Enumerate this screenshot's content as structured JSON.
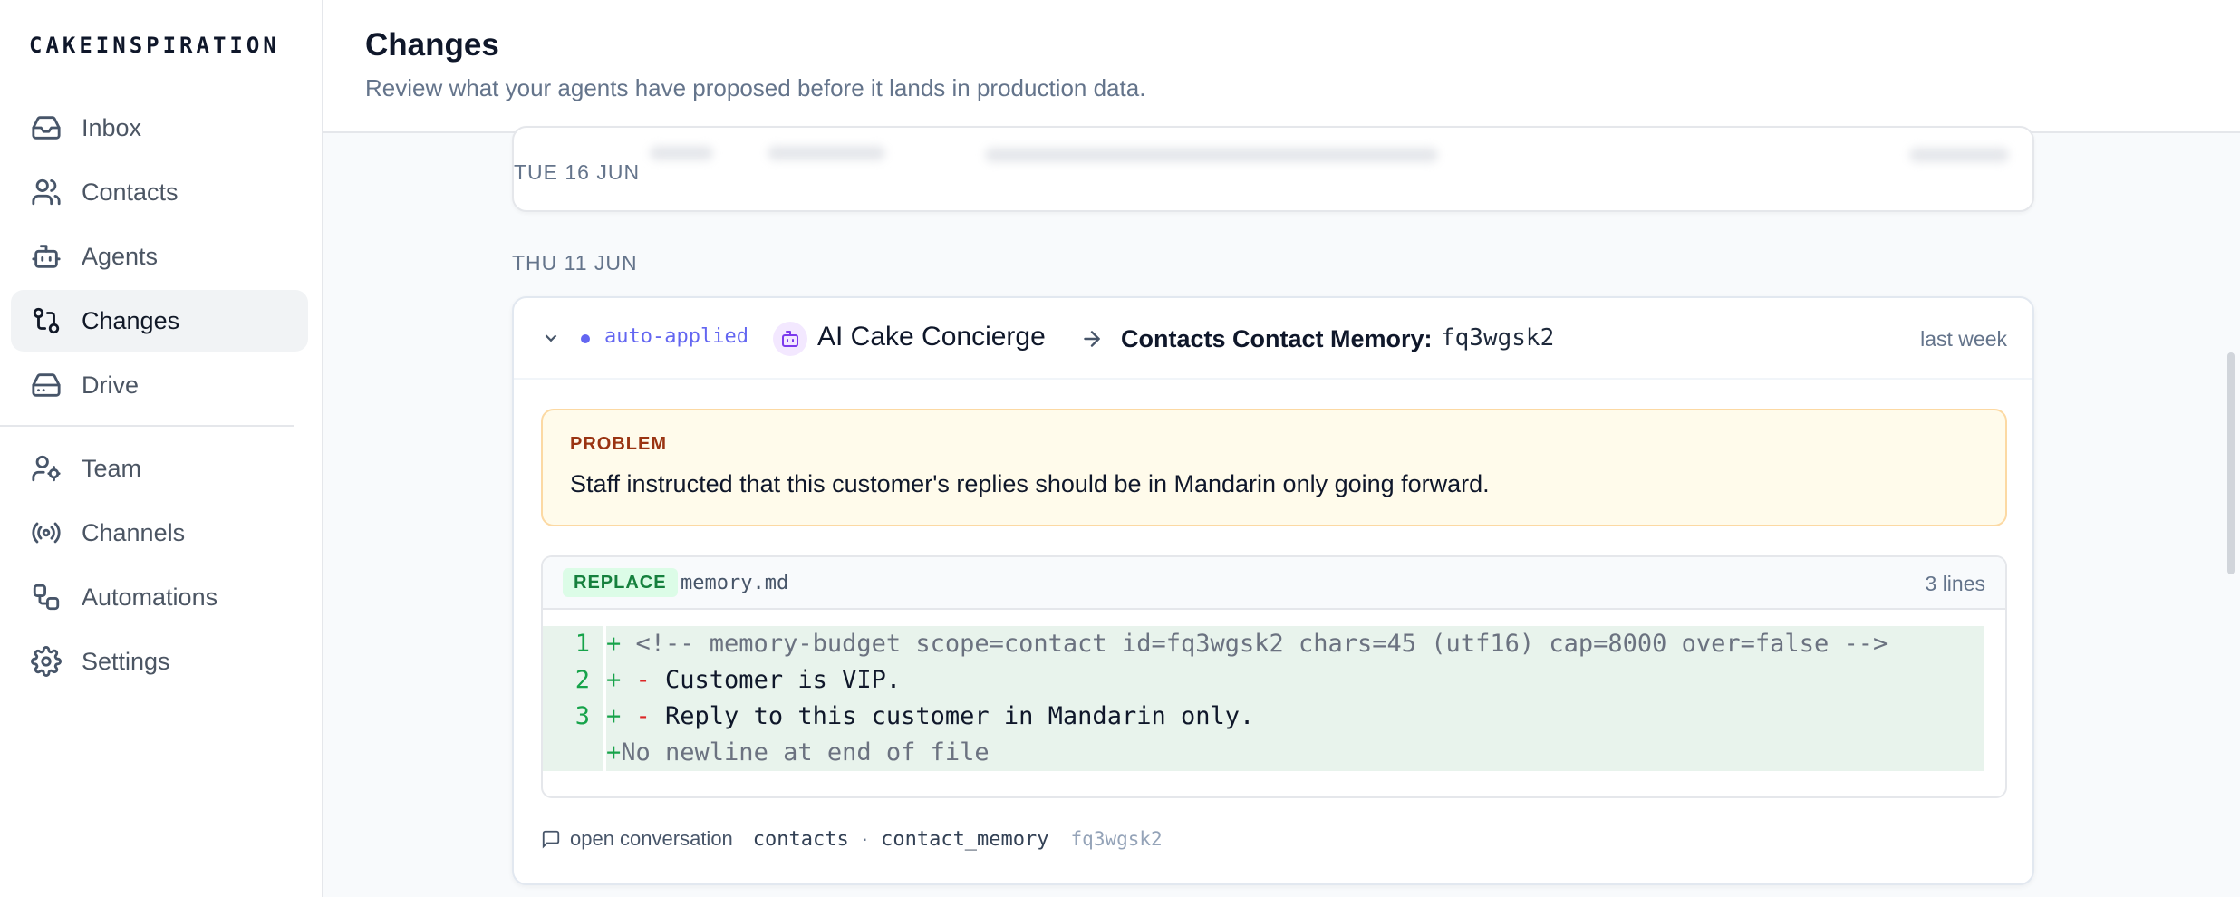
{
  "brand": "CAKEINSPIRATION",
  "nav": {
    "primary": [
      {
        "label": "Inbox",
        "icon": "inbox-icon"
      },
      {
        "label": "Contacts",
        "icon": "users-icon"
      },
      {
        "label": "Agents",
        "icon": "bot-icon"
      },
      {
        "label": "Changes",
        "icon": "git-compare-icon",
        "active": true
      },
      {
        "label": "Drive",
        "icon": "hard-drive-icon"
      }
    ],
    "secondary": [
      {
        "label": "Team",
        "icon": "user-cog-icon"
      },
      {
        "label": "Channels",
        "icon": "radio-icon"
      },
      {
        "label": "Automations",
        "icon": "workflow-icon"
      },
      {
        "label": "Settings",
        "icon": "gear-icon"
      }
    ]
  },
  "header": {
    "title": "Changes",
    "subtitle": "Review what your agents have proposed before it lands in production data."
  },
  "groups": [
    {
      "date": "TUE 16 JUN"
    },
    {
      "date": "THU 11 JUN"
    }
  ],
  "change": {
    "status": "auto-applied",
    "agent": "AI Cake Concierge",
    "target": "Contacts Contact Memory:",
    "target_id": "fq3wgsk2",
    "when": "last week",
    "problem_label": "PROBLEM",
    "problem_text": "Staff instructed that this customer's replies should be in Mandarin only going forward.",
    "op": "REPLACE",
    "file": "memory.md",
    "line_count": "3 lines",
    "lines": [
      {
        "n": "1",
        "prefix": "+ ",
        "text": "<!-- memory-budget scope=contact id=fq3wgsk2 chars=45 (utf16) cap=8000 over=false -->"
      },
      {
        "n": "2",
        "prefix": "+ ",
        "dash": "- ",
        "text": "Customer is VIP."
      },
      {
        "n": "3",
        "prefix": "+ ",
        "dash": "- ",
        "text": "Reply to this customer in Mandarin only."
      },
      {
        "n": "",
        "prefix": "+",
        "text": "No newline at end of file"
      }
    ],
    "footer": {
      "open": "open conversation",
      "table": "contacts",
      "sep": "·",
      "field": "contact_memory",
      "record_id": "fq3wgsk2"
    }
  },
  "colors": {
    "accent": "#6366f1",
    "agent": "#7c3aed",
    "added": "#16a34a",
    "problem_bg": "#fffbeb",
    "problem_border": "#fcd9a3"
  }
}
